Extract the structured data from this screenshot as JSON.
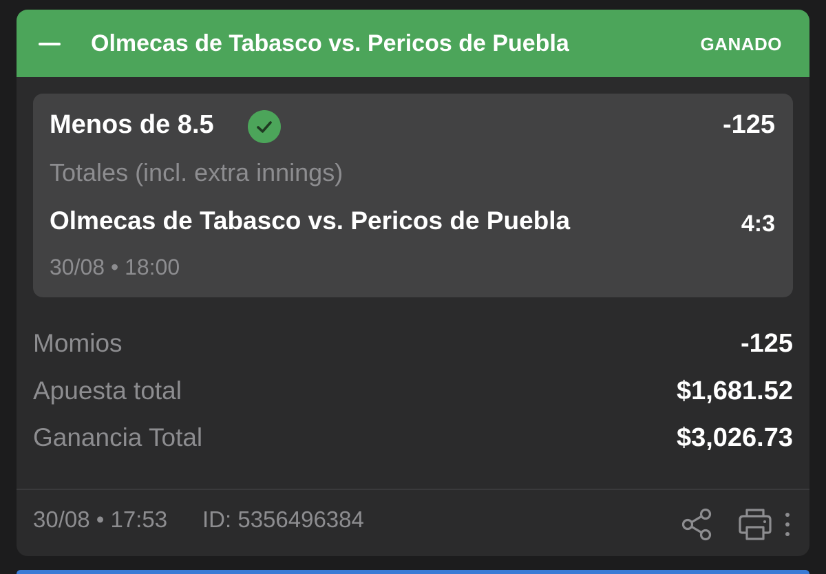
{
  "header": {
    "title": "Olmecas de Tabasco vs. Pericos de Puebla",
    "status": "GANADO",
    "accent_color": "#4ca55a",
    "collapse_icon": "minus-icon"
  },
  "selection": {
    "title": "Menos de 8.5",
    "result_icon": "check-circle-icon",
    "odds": "-125",
    "market": "Totales (incl. extra innings)",
    "event": "Olmecas de Tabasco vs. Pericos de Puebla",
    "score": "4:3",
    "datetime": "30/08 • 18:00"
  },
  "summary": {
    "odds_label": "Momios",
    "odds_value": "-125",
    "stake_label": "Apuesta total",
    "stake_value": "$1,681.52",
    "payout_label": "Ganancia Total",
    "payout_value": "$3,026.73"
  },
  "footer": {
    "datetime": "30/08 • 17:53",
    "bet_id": "ID: 5356496384",
    "icons": [
      "share-icon",
      "print-icon",
      "more-vertical-icon"
    ]
  }
}
